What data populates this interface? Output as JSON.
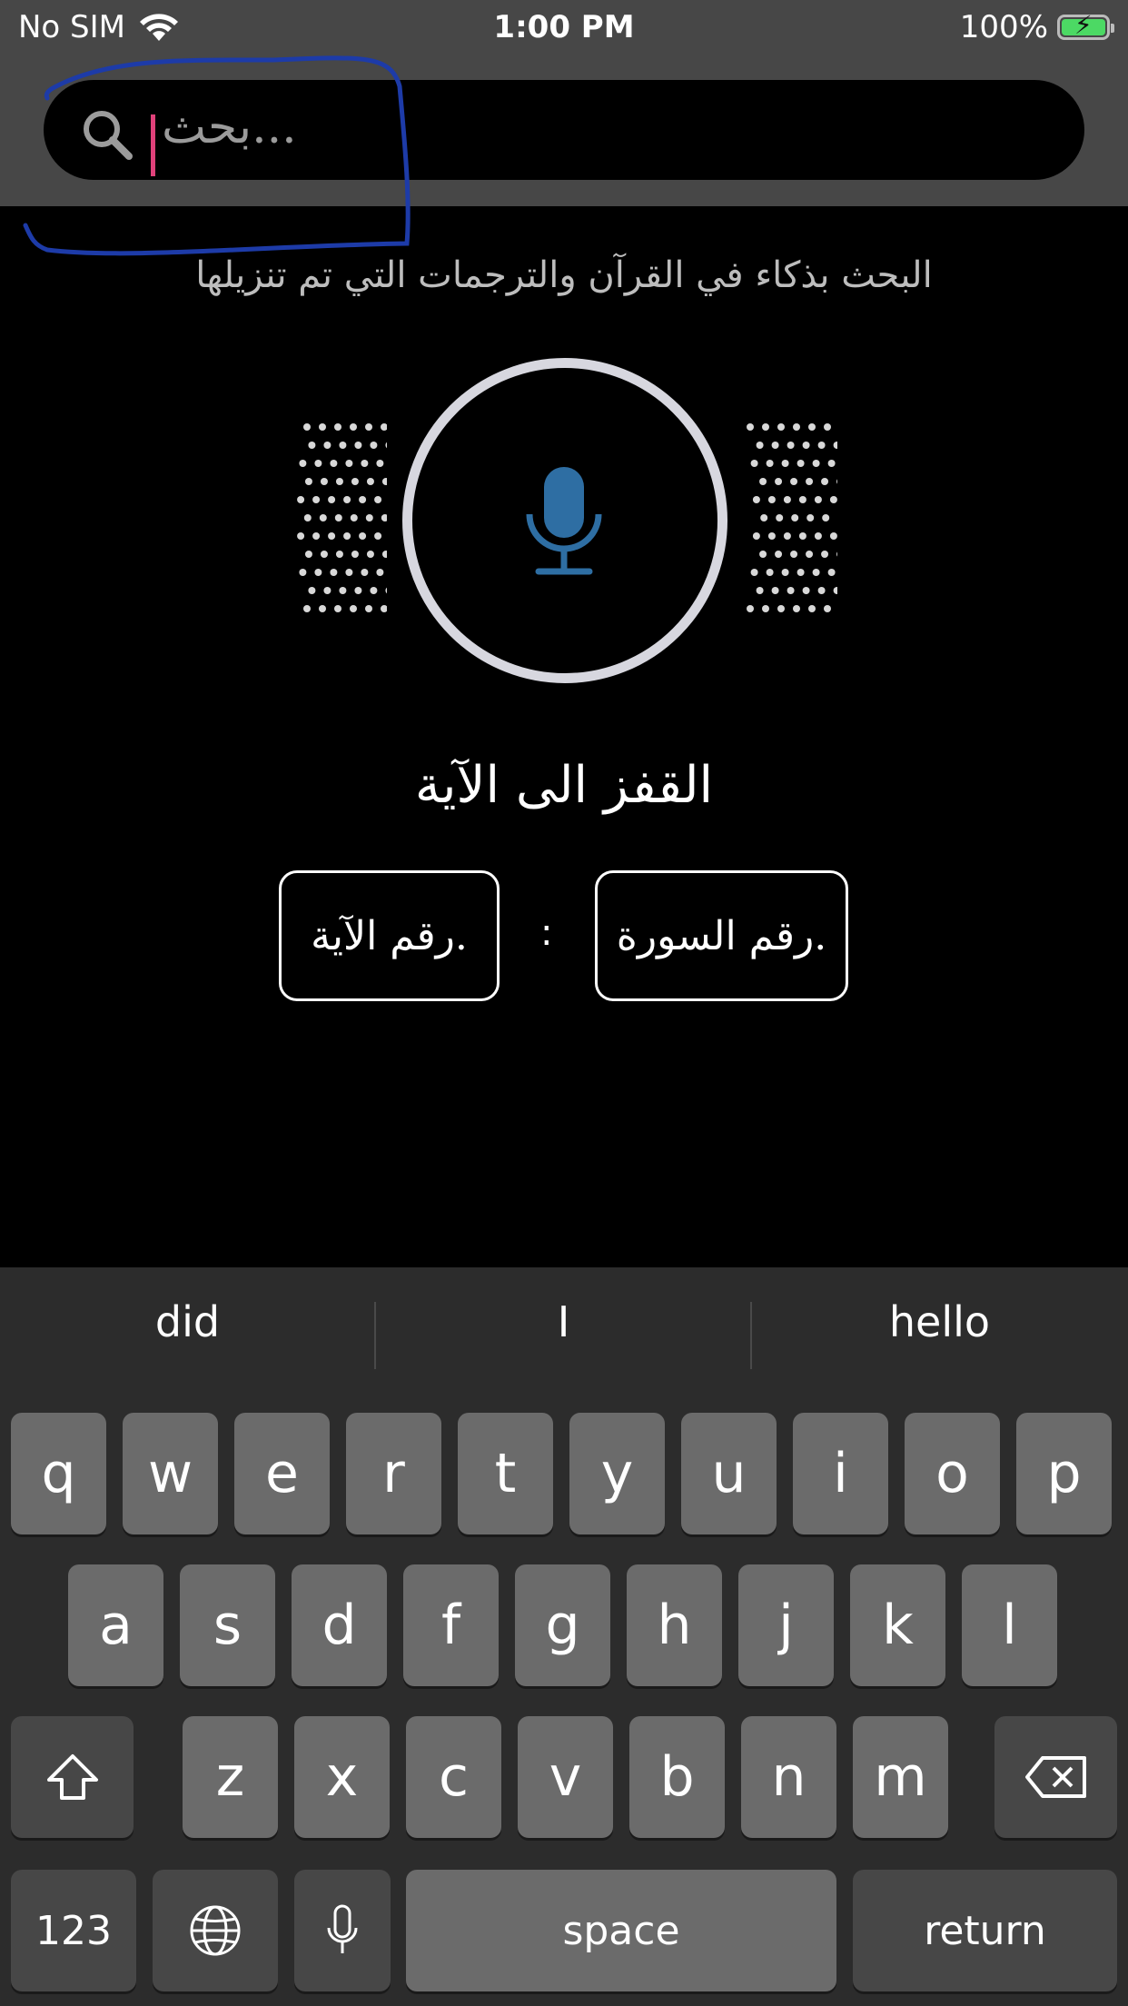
{
  "status_bar": {
    "carrier": "No SIM",
    "time": "1:00 PM",
    "battery_percent": "100%"
  },
  "search": {
    "placeholder": "بحث..."
  },
  "subtitle": "البحث بذكاء في القرآن والترجمات التي تم تنزيلها",
  "jump": {
    "title": "القفز الى الآية",
    "ayah_placeholder": "رقم الآية.",
    "separator": ":",
    "surah_placeholder": "رقم السورة."
  },
  "keyboard": {
    "suggestions": [
      "did",
      "I",
      "hello"
    ],
    "row1": [
      "q",
      "w",
      "e",
      "r",
      "t",
      "y",
      "u",
      "i",
      "o",
      "p"
    ],
    "row2": [
      "a",
      "s",
      "d",
      "f",
      "g",
      "h",
      "j",
      "k",
      "l"
    ],
    "row3": [
      "z",
      "x",
      "c",
      "v",
      "b",
      "n",
      "m"
    ],
    "numbers_label": "123",
    "space_label": "space",
    "return_label": "return"
  },
  "colors": {
    "header_bg": "#474747",
    "mic_blue": "#2e6ea3",
    "caret_pink": "#e0417a",
    "annotation_blue": "#1d3ba8"
  }
}
